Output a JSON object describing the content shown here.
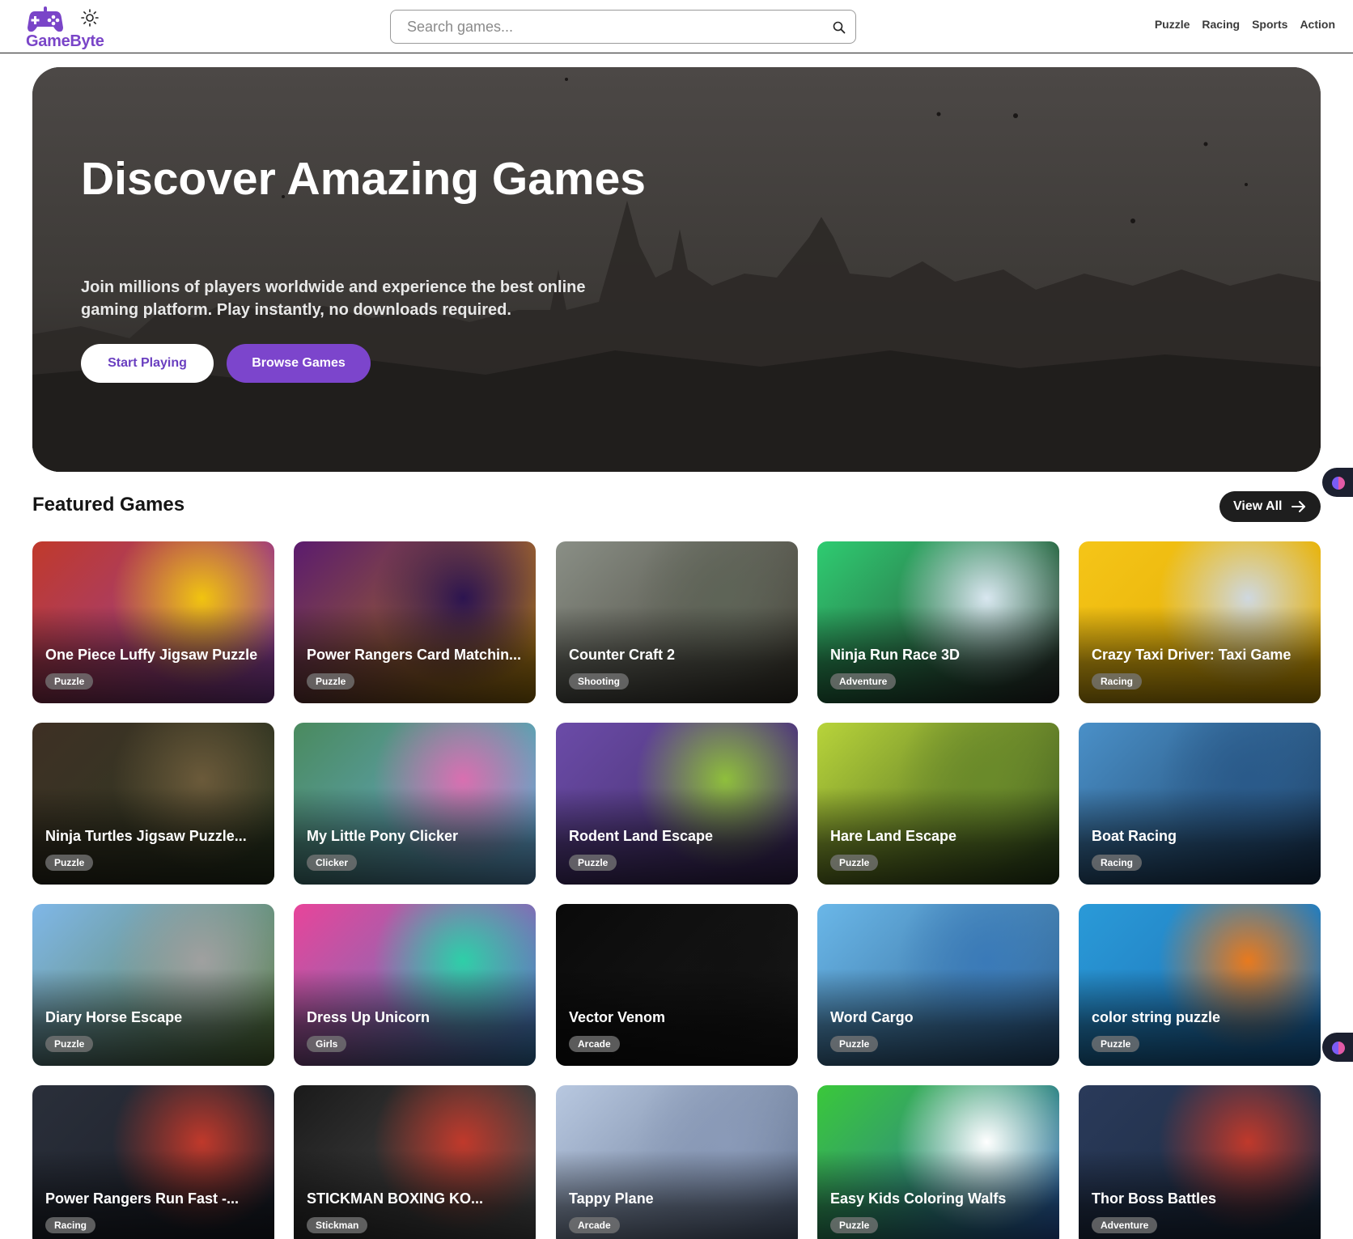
{
  "header": {
    "logo_text": "GameByte",
    "search_placeholder": "Search games...",
    "nav": [
      "Puzzle",
      "Racing",
      "Sports",
      "Action"
    ]
  },
  "hero": {
    "title": "Discover Amazing Games",
    "subtitle": "Join millions of players worldwide and experience the best online gaming platform. Play instantly, no downloads required.",
    "start_button": "Start Playing",
    "browse_button": "Browse Games"
  },
  "featured": {
    "title": "Featured Games",
    "view_all": "View All",
    "games": [
      {
        "title": "One Piece Luffy Jigsaw Puzzle",
        "tag": "Puzzle",
        "colors": [
          "#c0392b",
          "#f1c40f",
          "#8e44ad"
        ]
      },
      {
        "title": "Power Rangers Card Matchin...",
        "tag": "Puzzle",
        "colors": [
          "#5b1b6e",
          "#2c1450",
          "#b8860b"
        ]
      },
      {
        "title": "Counter Craft 2",
        "tag": "Shooting",
        "colors": [
          "#8a8f86",
          "#5e6457",
          "#3d3a30"
        ]
      },
      {
        "title": "Ninja Run Race 3D",
        "tag": "Adventure",
        "colors": [
          "#2ecc71",
          "#d9e7f0",
          "#2b2b2b"
        ]
      },
      {
        "title": "Crazy Taxi Driver: Taxi Game",
        "tag": "Racing",
        "colors": [
          "#f5c518",
          "#cfd8e0",
          "#e0a800"
        ]
      },
      {
        "title": "Ninja Turtles Jigsaw Puzzle...",
        "tag": "Puzzle",
        "colors": [
          "#3e3024",
          "#6b5a3a",
          "#2d3b22"
        ]
      },
      {
        "title": "My Little Pony Clicker",
        "tag": "Clicker",
        "colors": [
          "#4a8a5e",
          "#d96fb0",
          "#6ab0e8"
        ]
      },
      {
        "title": "Rodent Land Escape",
        "tag": "Puzzle",
        "colors": [
          "#6b4ba8",
          "#8fbf3c",
          "#3d2b5e"
        ]
      },
      {
        "title": "Hare Land Escape",
        "tag": "Puzzle",
        "colors": [
          "#b8d43a",
          "#6a8a2a",
          "#2e4a1e"
        ]
      },
      {
        "title": "Boat Racing",
        "tag": "Racing",
        "colors": [
          "#4a90c8",
          "#2a5a8a",
          "#1a3a5e"
        ]
      },
      {
        "title": "Diary Horse Escape",
        "tag": "Puzzle",
        "colors": [
          "#7fb7e8",
          "#a0a0a0",
          "#5a7a3a"
        ]
      },
      {
        "title": "Dress Up Unicorn",
        "tag": "Girls",
        "colors": [
          "#e8449a",
          "#2ecfa8",
          "#3a8ac8"
        ]
      },
      {
        "title": "Vector Venom",
        "tag": "Arcade",
        "colors": [
          "#0a0a0a",
          "#111111",
          "#1a1a1a"
        ]
      },
      {
        "title": "Word Cargo",
        "tag": "Puzzle",
        "colors": [
          "#6ab7e8",
          "#3a7ab8",
          "#2a5a8a"
        ]
      },
      {
        "title": "color string puzzle",
        "tag": "Puzzle",
        "colors": [
          "#2a9ad8",
          "#e87a1e",
          "#1a6ab0"
        ]
      },
      {
        "title": "Power Rangers Run Fast -...",
        "tag": "Racing",
        "colors": [
          "#2a2f3a",
          "#c0392b",
          "#1a1e28"
        ]
      },
      {
        "title": "STICKMAN BOXING KO...",
        "tag": "Stickman",
        "colors": [
          "#1a1a1a",
          "#c0392b",
          "#555555"
        ]
      },
      {
        "title": "Tappy Plane",
        "tag": "Arcade",
        "colors": [
          "#b8c8e0",
          "#8a9ab8",
          "#5a6a88"
        ]
      },
      {
        "title": "Easy Kids Coloring Walfs",
        "tag": "Puzzle",
        "colors": [
          "#3ac83a",
          "#ffffff",
          "#2a5ab8"
        ]
      },
      {
        "title": "Thor Boss Battles",
        "tag": "Adventure",
        "colors": [
          "#2a3a5a",
          "#c0392b",
          "#1a2a3e"
        ]
      }
    ]
  }
}
